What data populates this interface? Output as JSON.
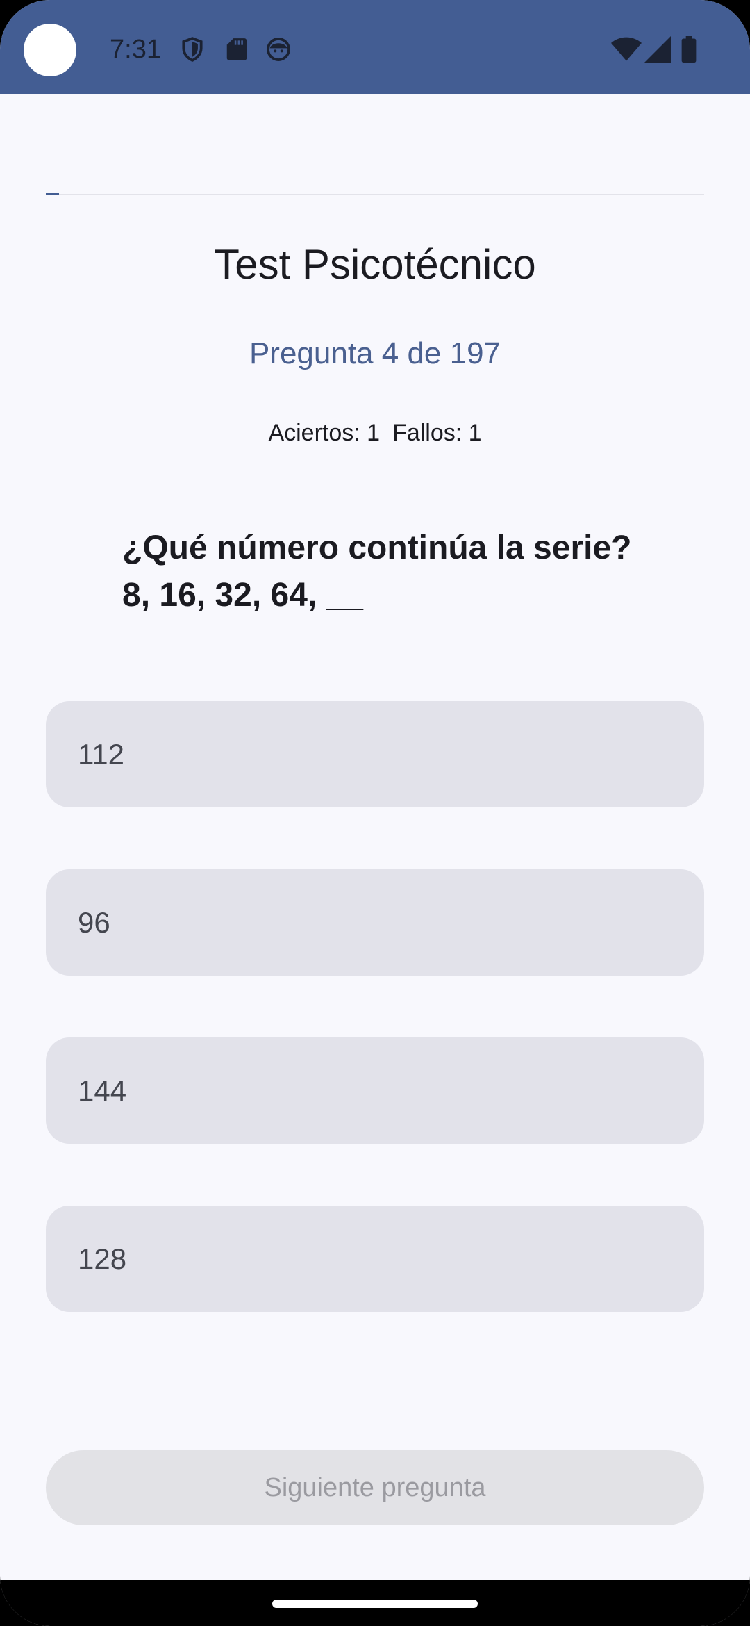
{
  "status_bar": {
    "time": "7:31",
    "icons_left": [
      "shield-icon",
      "sd-card-icon",
      "face-icon"
    ],
    "icons_right": [
      "wifi-icon",
      "signal-icon",
      "battery-icon"
    ]
  },
  "progress": {
    "current": 4,
    "total": 197,
    "fraction": 0.02
  },
  "header": {
    "title": "Test Psicotécnico",
    "question_counter": "Pregunta 4 de 197",
    "hits": "Aciertos: 1",
    "misses": "Fallos: 1"
  },
  "question": {
    "line1": "¿Qué número continúa la serie?",
    "line2": "8, 16, 32, 64, __"
  },
  "options": [
    "112",
    "96",
    "144",
    "128"
  ],
  "next_button": {
    "label": "Siguiente pregunta",
    "enabled": false
  },
  "colors": {
    "accent": "#435d93",
    "background": "#f8f8fd",
    "option_bg": "#e2e2ea",
    "text": "#1b1b21"
  }
}
